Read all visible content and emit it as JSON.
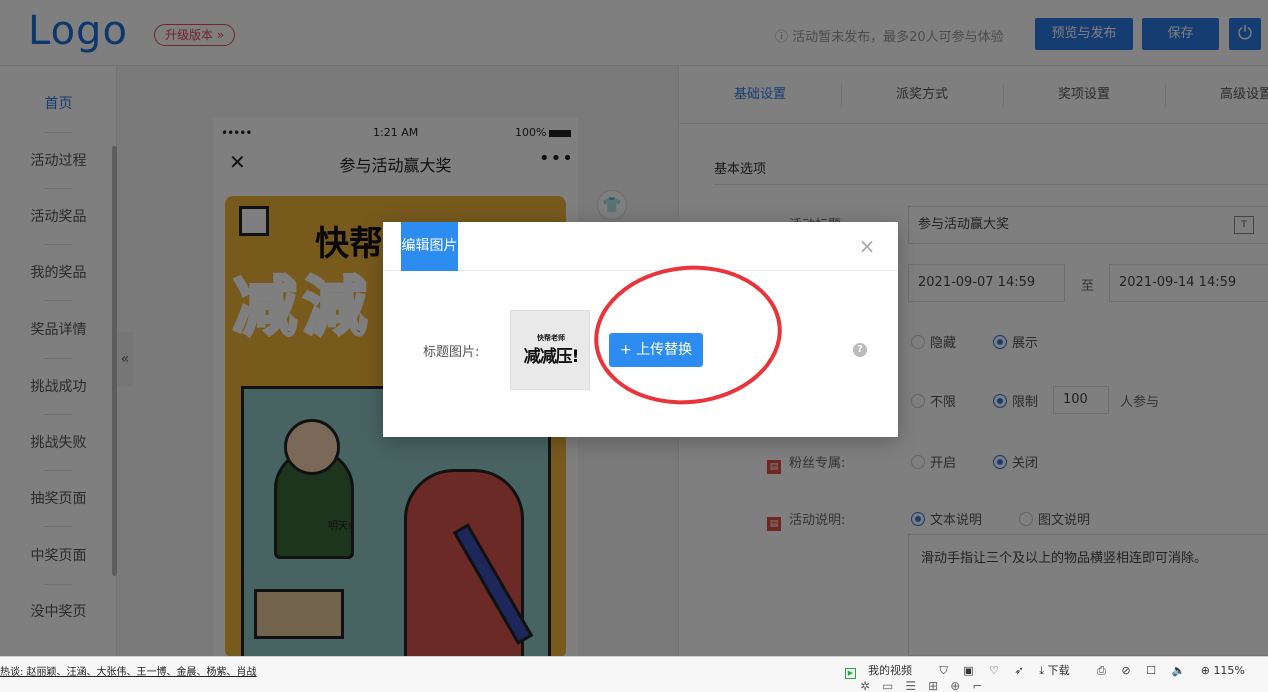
{
  "header": {
    "logo": "Logo",
    "upgrade": "升级版本 »",
    "notice": "ⓘ 活动暂未发布，最多20人可参与体验",
    "publish": "预览与发布",
    "save": "保存",
    "power_icon": "⏻"
  },
  "sidebar": {
    "items": [
      "首页",
      "活动过程",
      "活动奖品",
      "我的奖品",
      "奖品详情",
      "挑战成功",
      "挑战失败",
      "抽奖页面",
      "中奖页面",
      "没中奖页"
    ]
  },
  "phone": {
    "dots": "•••••",
    "time": "1:21 AM",
    "battery": "100%",
    "close": "✕",
    "title": "参与活动赢大奖",
    "more": "•••",
    "poster_title": "快帮",
    "poster_big": "减減",
    "poster_caption": "明天!"
  },
  "panel": {
    "tabs": [
      "基础设置",
      "派奖方式",
      "奖项设置",
      "高级设置"
    ],
    "section": "基本选项",
    "field_title_label": "活动标题",
    "field_title_value": "参与活动赢大奖",
    "date_start": "2021-09-07 14:59",
    "date_sep": "至",
    "date_end": "2021-09-14 14:59",
    "visibility": [
      "隐藏",
      "展示"
    ],
    "limit": [
      "不限",
      "限制"
    ],
    "limit_value": "100",
    "limit_unit": "人参与",
    "fans_label": "粉丝专属:",
    "fans": [
      "开启",
      "关闭"
    ],
    "desc_label": "活动说明:",
    "desc_opts": [
      "文本说明",
      "图文说明"
    ],
    "desc_text": "滑动手指让三个及以上的物品横竖相连即可消除。"
  },
  "modal": {
    "title": "编辑图片",
    "close": "×",
    "label": "标题图片:",
    "thumb_small": "快帮老师",
    "thumb_big": "减减压!",
    "upload": "+ 上传替换",
    "help": "?"
  },
  "statusbar": {
    "talk": "热谈: 赵丽颖、汪涵、大张伟、王一博、金晨、杨紫、肖战",
    "video": "我的视频",
    "download": "下载",
    "zoom": "115%"
  },
  "colors": {
    "accent": "#2d8cf0",
    "annotation": "#e8343a",
    "upgrade": "#e24a5a"
  }
}
